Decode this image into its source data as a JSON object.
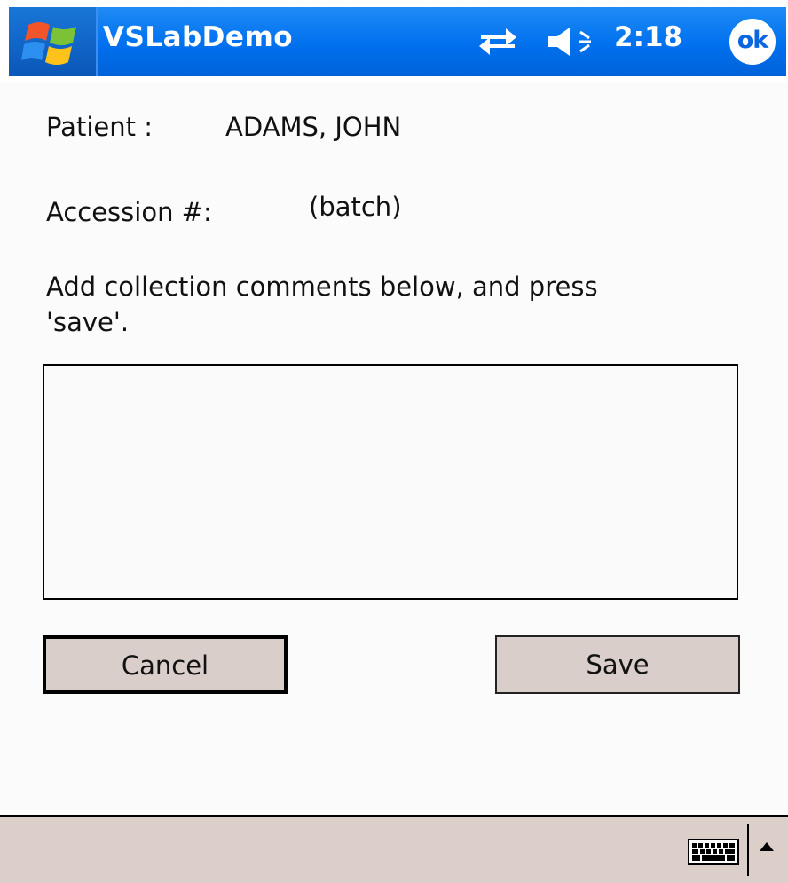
{
  "titlebar": {
    "app_title": "VSLabDemo",
    "clock": "2:18",
    "ok_label": "ok",
    "icons": [
      "windows-start-icon",
      "connectivity-icon",
      "volume-icon"
    ]
  },
  "form": {
    "patient_label": "Patient :",
    "patient_value": "ADAMS, JOHN",
    "accession_label": "Accession #:",
    "accession_value": "(batch)",
    "instructions_line1": "Add collection comments below, and press",
    "instructions_line2": "'save'.",
    "comments_value": ""
  },
  "buttons": {
    "cancel_label": "Cancel",
    "save_label": "Save"
  },
  "menubar": {
    "icons": [
      "keyboard-icon",
      "arrow-up-icon"
    ]
  }
}
